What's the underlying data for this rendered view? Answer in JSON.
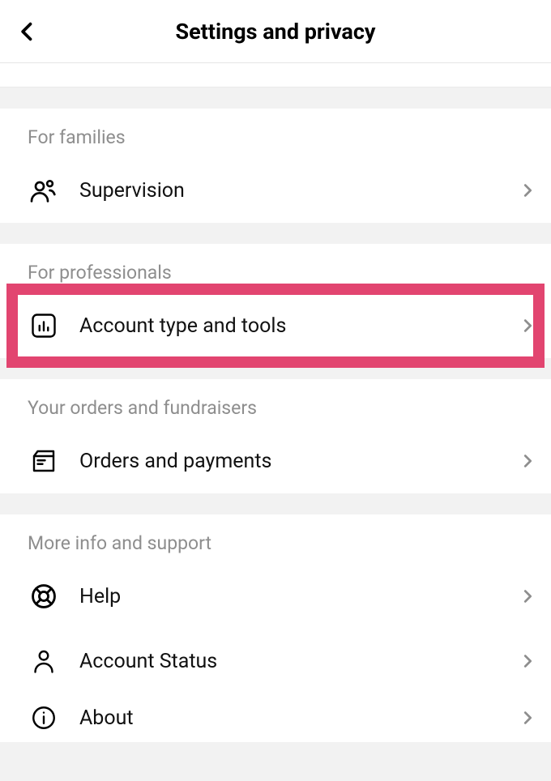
{
  "header": {
    "title": "Settings and privacy"
  },
  "sections": {
    "families": {
      "header": "For families",
      "supervision": "Supervision"
    },
    "professionals": {
      "header": "For professionals",
      "accountType": "Account type and tools"
    },
    "orders": {
      "header": "Your orders and fundraisers",
      "orders": "Orders and payments"
    },
    "support": {
      "header": "More info and support",
      "help": "Help",
      "status": "Account Status",
      "about": "About"
    }
  }
}
